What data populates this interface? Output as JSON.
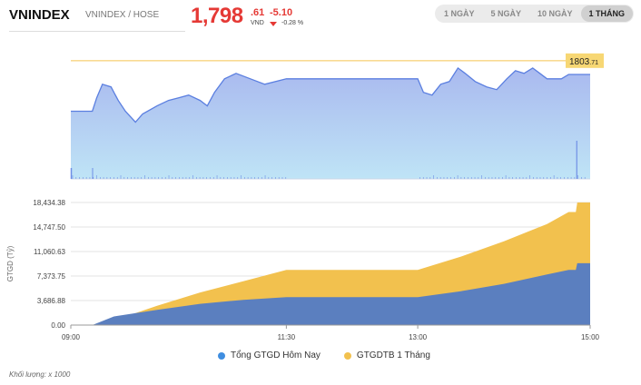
{
  "header": {
    "index_name": "VNINDEX",
    "exchange": "VNINDEX / HOSE",
    "price_int": "1,798",
    "price_dec": ".61",
    "unit": "VND",
    "change": "-5.10",
    "change_pct": "-0.28 %"
  },
  "tabs": [
    {
      "label": "1 NGÀY",
      "active": false
    },
    {
      "label": "5 NGÀY",
      "active": false
    },
    {
      "label": "10 NGÀY",
      "active": false
    },
    {
      "label": "1 THÁNG",
      "active": true
    }
  ],
  "colors": {
    "price_line": "#5b7fe0",
    "price_fill_top": "#a9b9ef",
    "price_fill_bottom": "#bfe4f6",
    "ref_line": "#f5c451",
    "down": "#e53935",
    "today_series": "#5b7fbf",
    "month_avg_series": "#f2c14e"
  },
  "chart_data": [
    {
      "type": "line",
      "reference_label": "1803",
      "reference_label_dec": ".71",
      "reference_value": 1803.71,
      "grid": false,
      "price": [
        [
          "09:00",
          1785.0
        ],
        [
          "09:10",
          1785.0
        ],
        [
          "09:15",
          1785.0
        ],
        [
          "09:18",
          1790.0
        ],
        [
          "09:22",
          1795.0
        ],
        [
          "09:28",
          1794.0
        ],
        [
          "09:33",
          1789.0
        ],
        [
          "09:38",
          1785.0
        ],
        [
          "09:45",
          1781.0
        ],
        [
          "09:50",
          1784.0
        ],
        [
          "10:00",
          1787.0
        ],
        [
          "10:08",
          1789.0
        ],
        [
          "10:15",
          1790.0
        ],
        [
          "10:22",
          1791.0
        ],
        [
          "10:30",
          1789.0
        ],
        [
          "10:35",
          1787.0
        ],
        [
          "10:40",
          1792.0
        ],
        [
          "10:47",
          1797.0
        ],
        [
          "10:55",
          1799.0
        ],
        [
          "11:05",
          1797.0
        ],
        [
          "11:15",
          1795.0
        ],
        [
          "11:30",
          1797.0
        ],
        [
          "13:00",
          1797.0
        ],
        [
          "13:04",
          1792.0
        ],
        [
          "13:10",
          1791.0
        ],
        [
          "13:16",
          1795.0
        ],
        [
          "13:22",
          1796.0
        ],
        [
          "13:28",
          1801.0
        ],
        [
          "13:33",
          1799.0
        ],
        [
          "13:40",
          1796.0
        ],
        [
          "13:48",
          1794.0
        ],
        [
          "13:55",
          1793.0
        ],
        [
          "14:02",
          1797.0
        ],
        [
          "14:08",
          1800.0
        ],
        [
          "14:14",
          1799.0
        ],
        [
          "14:20",
          1801.0
        ],
        [
          "14:25",
          1799.0
        ],
        [
          "14:30",
          1797.0
        ],
        [
          "14:40",
          1797.0
        ],
        [
          "14:45",
          1798.61
        ],
        [
          "15:00",
          1798.61
        ]
      ],
      "volume_spike_time": "14:45"
    },
    {
      "type": "area",
      "ylabel": "GTGD (Tỷ)",
      "ylim": [
        0,
        18434.38
      ],
      "yticks": [
        "0.00",
        "3,686.88",
        "7,373.75",
        "11,060.63",
        "14,747.50",
        "18,434.38"
      ],
      "ytick_values": [
        0,
        3686.88,
        7373.75,
        11060.63,
        14747.5,
        18434.38
      ],
      "xticks": [
        "09:00",
        "11:30",
        "13:00",
        "15:00"
      ],
      "series": [
        {
          "name": "GTGDTB 1 Tháng",
          "points": [
            [
              "09:00",
              0
            ],
            [
              "09:15",
              0
            ],
            [
              "09:30",
              700
            ],
            [
              "10:00",
              2900
            ],
            [
              "10:30",
              4900
            ],
            [
              "11:00",
              6600
            ],
            [
              "11:30",
              8300
            ],
            [
              "13:00",
              8300
            ],
            [
              "13:30",
              10300
            ],
            [
              "14:00",
              12600
            ],
            [
              "14:30",
              15200
            ],
            [
              "14:45",
              17000
            ],
            [
              "14:50",
              17000
            ],
            [
              "14:51",
              18434.38
            ],
            [
              "15:00",
              18434.38
            ]
          ]
        },
        {
          "name": "Tổng GTGD Hôm Nay",
          "points": [
            [
              "09:00",
              0
            ],
            [
              "09:15",
              0
            ],
            [
              "09:30",
              1300
            ],
            [
              "10:00",
              2300
            ],
            [
              "10:30",
              3200
            ],
            [
              "11:00",
              3800
            ],
            [
              "11:30",
              4200
            ],
            [
              "13:00",
              4200
            ],
            [
              "13:30",
              5100
            ],
            [
              "14:00",
              6200
            ],
            [
              "14:30",
              7600
            ],
            [
              "14:45",
              8300
            ],
            [
              "14:50",
              8300
            ],
            [
              "14:51",
              9300
            ],
            [
              "15:00",
              9300
            ]
          ]
        }
      ]
    }
  ],
  "legend": {
    "today": "Tổng GTGD Hôm Nay",
    "month_avg": "GTGDTB 1 Tháng"
  },
  "footnote": "Khối lượng: x 1000"
}
